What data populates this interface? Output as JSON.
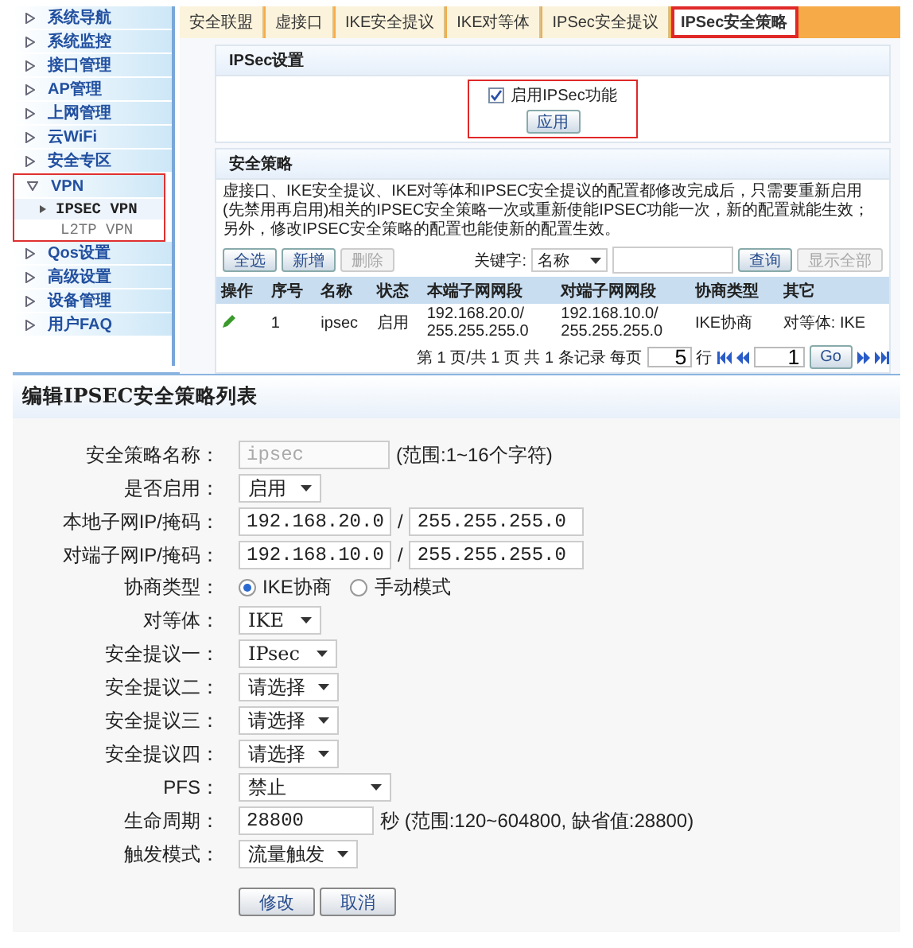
{
  "sidebar": {
    "items": [
      {
        "label": "系统导航",
        "expanded": false,
        "highlighted": false
      },
      {
        "label": "系统监控",
        "expanded": false,
        "highlighted": false
      },
      {
        "label": "接口管理",
        "expanded": false,
        "highlighted": false
      },
      {
        "label": "AP管理",
        "expanded": false,
        "highlighted": false
      },
      {
        "label": "上网管理",
        "expanded": false,
        "highlighted": false
      },
      {
        "label": "云WiFi",
        "expanded": false,
        "highlighted": false
      },
      {
        "label": "安全专区",
        "expanded": false,
        "highlighted": false
      },
      {
        "label": "VPN",
        "expanded": true,
        "highlighted": true,
        "children": [
          {
            "label": "IPSEC VPN",
            "selected": true
          },
          {
            "label": "L2TP VPN",
            "selected": false
          }
        ]
      },
      {
        "label": "Qos设置",
        "expanded": false,
        "highlighted": false
      },
      {
        "label": "高级设置",
        "expanded": false,
        "highlighted": false
      },
      {
        "label": "设备管理",
        "expanded": false,
        "highlighted": false
      },
      {
        "label": "用户FAQ",
        "expanded": false,
        "highlighted": false
      }
    ]
  },
  "tabs": [
    {
      "label": "安全联盟",
      "selected": false,
      "highlighted": false
    },
    {
      "label": "虚接口",
      "selected": false,
      "highlighted": false
    },
    {
      "label": "IKE安全提议",
      "selected": false,
      "highlighted": false
    },
    {
      "label": "IKE对等体",
      "selected": false,
      "highlighted": false
    },
    {
      "label": "IPSec安全提议",
      "selected": false,
      "highlighted": false
    },
    {
      "label": "IPSec安全策略",
      "selected": true,
      "highlighted": true
    }
  ],
  "ipsec_settings": {
    "title": "IPSec设置",
    "highlighted": true,
    "enable": {
      "label": "启用IPSec功能",
      "checked": true
    },
    "apply_button": "应用"
  },
  "policy": {
    "title": "安全策略",
    "note": "虚接口、IKE安全提议、IKE对等体和IPSEC安全提议的配置都修改完成后，只需要重新启用(先禁用再启用)相关的IPSEC安全策略一次或重新使能IPSEC功能一次，新的配置就能生效；另外，修改IPSEC安全策略的配置也能使新的配置生效。",
    "action_buttons": [
      {
        "label": "全选",
        "disabled": false
      },
      {
        "label": "新增",
        "disabled": false
      },
      {
        "label": "删除",
        "disabled": true
      }
    ],
    "keyword_label": "关键字:",
    "keyword_select": "名称",
    "search_buttons": [
      {
        "label": "查询",
        "disabled": false
      },
      {
        "label": "显示全部",
        "disabled": true
      }
    ],
    "table": {
      "columns": [
        "操作",
        "序号",
        "名称",
        "状态",
        "本端子网网段",
        "对端子网网段",
        "协商类型",
        "其它"
      ],
      "rows": [
        {
          "index": "1",
          "name": "ipsec",
          "status": "启用",
          "local_subnet": [
            "192.168.20.0/",
            "255.255.255.0"
          ],
          "remote_subnet": [
            "192.168.10.0/",
            "255.255.255.0"
          ],
          "negotiation": "IKE协商",
          "other": "对等体: IKE"
        }
      ]
    },
    "pagination": {
      "summary": "第 1 页/共 1 页 共 1 条记录 每页",
      "per_page": "5",
      "per_page_unit": "行",
      "page": "1",
      "go_button": "Go"
    }
  },
  "edit_form": {
    "title": "编辑IPSEC安全策略列表",
    "fields": [
      {
        "kind": "text",
        "label": "安全策略名称：",
        "value": "ipsec",
        "disabled": true,
        "hint": "(范围:1~16个字符)"
      },
      {
        "kind": "select",
        "label": "是否启用：",
        "value": "启用"
      },
      {
        "kind": "ip_pair",
        "label": "本地子网IP/掩码：",
        "ip": "192.168.20.0",
        "separator": "/",
        "mask": "255.255.255.0"
      },
      {
        "kind": "ip_pair",
        "label": "对端子网IP/掩码：",
        "ip": "192.168.10.0",
        "separator": "/",
        "mask": "255.255.255.0"
      },
      {
        "kind": "radio",
        "label": "协商类型：",
        "options": [
          {
            "label": "IKE协商",
            "selected": true
          },
          {
            "label": "手动模式",
            "selected": false
          }
        ]
      },
      {
        "kind": "select",
        "label": "对等体：",
        "value": "IKE"
      },
      {
        "kind": "select",
        "label": "安全提议一：",
        "value": "IPsec"
      },
      {
        "kind": "select",
        "label": "安全提议二：",
        "value": "请选择"
      },
      {
        "kind": "select",
        "label": "安全提议三：",
        "value": "请选择"
      },
      {
        "kind": "select",
        "label": "安全提议四：",
        "value": "请选择"
      },
      {
        "kind": "wide_select",
        "label": "PFS：",
        "value": "禁止"
      },
      {
        "kind": "text",
        "label": "生命周期：",
        "value": "28800",
        "disabled": false,
        "hint": "秒 (范围:120~604800, 缺省值:28800)"
      },
      {
        "kind": "select",
        "label": "触发模式：",
        "value": "流量触发"
      }
    ],
    "buttons": [
      "修改",
      "取消"
    ]
  }
}
